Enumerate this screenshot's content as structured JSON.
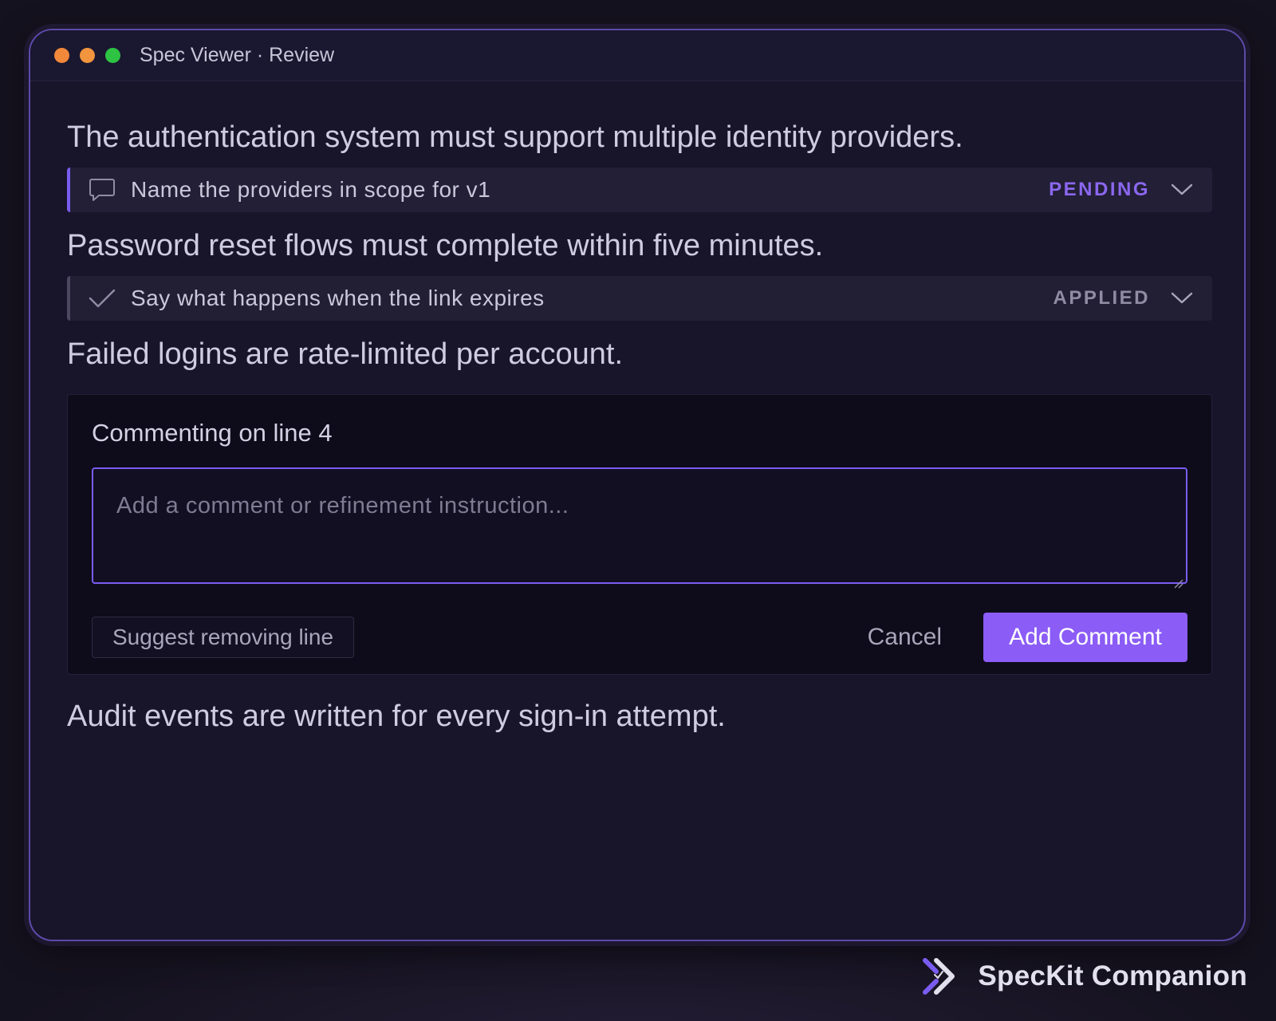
{
  "window": {
    "title": "Spec Viewer · Review"
  },
  "spec": {
    "line1": "The authentication system must support multiple identity providers.",
    "comment1": {
      "text": "Name the providers in scope for v1",
      "status": "PENDING",
      "icon": "comment-icon"
    },
    "line2": "Password reset flows must complete within five minutes.",
    "comment2": {
      "text": "Say what happens when the link expires",
      "status": "APPLIED",
      "icon": "check-icon"
    },
    "line3": "Failed logins are rate-limited per account.",
    "line4": "Audit events are written for every sign-in attempt."
  },
  "editor": {
    "title": "Commenting on line 4",
    "placeholder": "Add a comment or refinement instruction...",
    "suggest_label": "Suggest removing line",
    "cancel_label": "Cancel",
    "submit_label": "Add Comment"
  },
  "brand": {
    "name": "SpecKit Companion"
  },
  "colors": {
    "accent": "#8b5cf6",
    "pending": "#8b67ef",
    "applied": "#8f8ca3",
    "background": "#18152a"
  }
}
